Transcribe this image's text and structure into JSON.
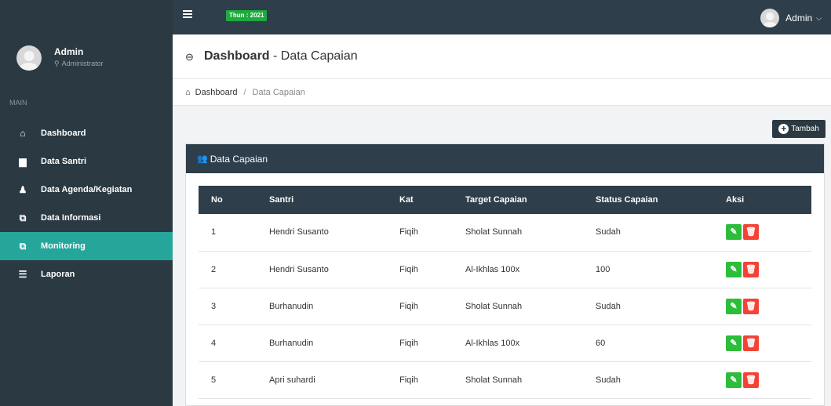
{
  "topbar": {
    "year_badge": "Thun : 2021",
    "user_label": "Admin",
    "chevron": "⌵",
    "menu_icon": "hamburger-icon"
  },
  "sidebar": {
    "user_name": "Admin",
    "user_role": "Administrator",
    "section_label": "MAIN",
    "items": [
      {
        "label": "Dashboard",
        "icon": "home-icon",
        "glyph": "⌂"
      },
      {
        "label": "Data Santri",
        "icon": "book-icon",
        "glyph": "▆"
      },
      {
        "label": "Data Agenda/Kegiatan",
        "icon": "user-icon",
        "glyph": "♟"
      },
      {
        "label": "Data Informasi",
        "icon": "clone-icon",
        "glyph": "⧉"
      },
      {
        "label": "Monitoring",
        "icon": "clone-icon",
        "glyph": "⧉"
      },
      {
        "label": "Laporan",
        "icon": "list-icon",
        "glyph": "☰"
      }
    ],
    "active_index": 4
  },
  "header": {
    "title_bold": "Dashboard",
    "title_rest": " - Data Capaian",
    "back_glyph": "⊖"
  },
  "breadcrumb": {
    "home": "Dashboard",
    "separator": "/",
    "current": "Data Capaian"
  },
  "toolbar": {
    "add_label": "Tambah"
  },
  "panel": {
    "title": "Data Capaian"
  },
  "table": {
    "headers": [
      "No",
      "Santri",
      "Kat",
      "Target Capaian",
      "Status Capaian",
      "Aksi"
    ],
    "rows": [
      {
        "no": "1",
        "santri": "Hendri Susanto",
        "kat": "Fiqih",
        "target": "Sholat Sunnah",
        "status": "Sudah"
      },
      {
        "no": "2",
        "santri": "Hendri Susanto",
        "kat": "Fiqih",
        "target": "Al-Ikhlas 100x",
        "status": "100"
      },
      {
        "no": "3",
        "santri": "Burhanudin",
        "kat": "Fiqih",
        "target": "Sholat Sunnah",
        "status": "Sudah"
      },
      {
        "no": "4",
        "santri": "Burhanudin",
        "kat": "Fiqih",
        "target": "Al-Ikhlas 100x",
        "status": "60"
      },
      {
        "no": "5",
        "santri": "Apri suhardi",
        "kat": "Fiqih",
        "target": "Sholat Sunnah",
        "status": "Sudah"
      }
    ]
  },
  "colors": {
    "sidebar_bg": "#2b3942",
    "active": "#26a69a",
    "edit": "#2dbd3a",
    "delete": "#f44336",
    "badge": "#1eaa3e"
  }
}
